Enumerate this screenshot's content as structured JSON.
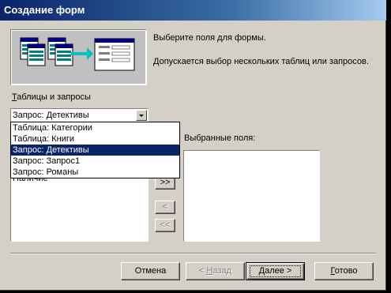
{
  "window": {
    "title": "Создание форм"
  },
  "instructions": {
    "line1": "Выберите поля для формы.",
    "line2": "Допускается выбор нескольких таблиц или запросов."
  },
  "tables_label": {
    "accel": "Т",
    "rest": "аблицы и запросы"
  },
  "combo": {
    "value": "Запрос: Детективы"
  },
  "dropdown": {
    "items": [
      "Таблица: Категории",
      "Таблица: Книги",
      "Запрос: Детективы",
      "Запрос: Запрос1",
      "Запрос: Романы"
    ],
    "selected_index": 2
  },
  "available_fields": {
    "visible_item": "Наличие"
  },
  "selected_fields": {
    "label": "Выбранные поля:"
  },
  "move_buttons": {
    "add_all": ">>",
    "remove_one": "<",
    "remove_all": "<<"
  },
  "footer": {
    "cancel_label": "Отмена",
    "back_label": {
      "prefix": "< ",
      "accel": "Н",
      "rest": "азад"
    },
    "next_label": {
      "accel": "Д",
      "rest": "алее >"
    },
    "finish_label": {
      "accel": "Г",
      "rest": "отово"
    }
  },
  "colors": {
    "titlebar_start": "#0a246a",
    "titlebar_end": "#a6caf0",
    "window_face": "#d4d0c8",
    "highlight": "#0a246a"
  }
}
